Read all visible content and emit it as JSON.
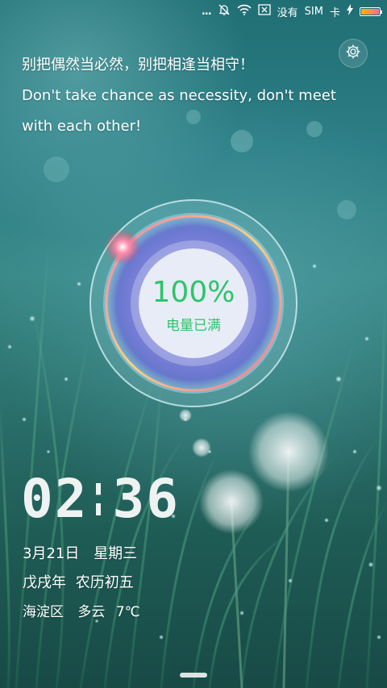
{
  "status_bar": {
    "more": "...",
    "no_service": "没有",
    "sim": "SIM",
    "card": "卡",
    "battery_level": 1.0,
    "icons": [
      "mute-bell-icon",
      "wifi-icon",
      "sim-x-icon",
      "charging-bolt-icon",
      "battery-icon"
    ]
  },
  "settings": {
    "icon": "gear-icon"
  },
  "quote": {
    "zh": "别把偶然当必然，别把相逢当相守！",
    "en_line1": "Don't take chance as necessity, don't meet",
    "en_line2": "with each other!"
  },
  "charge": {
    "percent_text": "100%",
    "status_text": "电量已满",
    "level": 1.0,
    "color": "#2ec46a"
  },
  "clock": {
    "hours": "02",
    "minutes": "36"
  },
  "date": {
    "date": "3月21日",
    "weekday": "星期三"
  },
  "lunar": {
    "year": "戊戌年",
    "day": "农历初五"
  },
  "weather": {
    "district": "海淀区",
    "condition": "多云",
    "temperature": "7℃"
  }
}
